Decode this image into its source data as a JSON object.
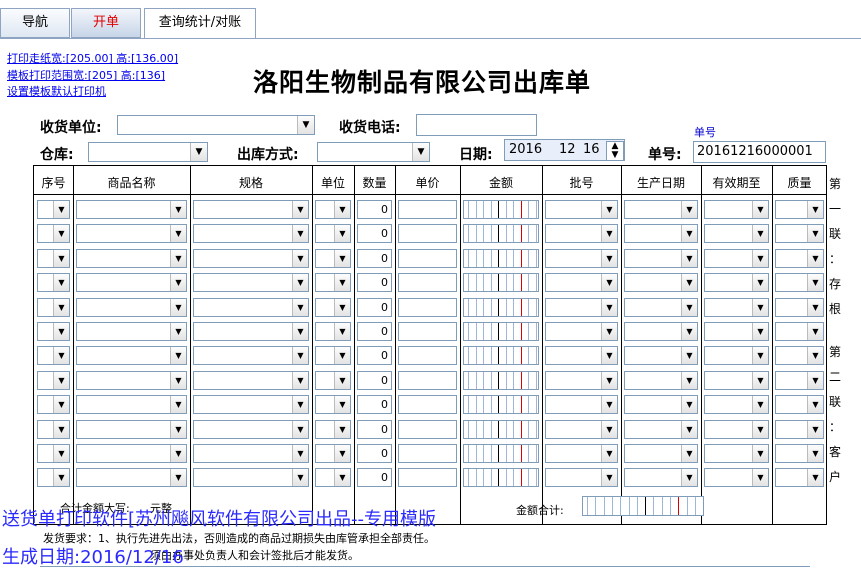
{
  "tabs": [
    {
      "label": "导航"
    },
    {
      "label": "开单"
    },
    {
      "label": "查询统计/对账"
    }
  ],
  "print_links": [
    "打印走纸宽:[205.00] 高:[136.00]",
    "模板打印范围宽:[205] 高:[136]",
    "设置模板默认打印机"
  ],
  "title": "洛阳生物制品有限公司出库单",
  "form": {
    "receiver_label": "收货单位:",
    "phone_label": "收货电话:",
    "warehouse_label": "仓库:",
    "method_label": "出库方式:",
    "date_label": "日期:",
    "date_year": "2016",
    "date_month": "12",
    "date_day": "16",
    "order_caption": "单号",
    "order_label": "单号:",
    "order_value": "20161216000001"
  },
  "columns": [
    "序号",
    "商品名称",
    "规格",
    "单位",
    "数量",
    "单价",
    "金额",
    "批号",
    "生产日期",
    "有效期至",
    "质量"
  ],
  "row_qty": [
    "0",
    "0",
    "0",
    "0",
    "0",
    "0",
    "0",
    "0",
    "0",
    "0",
    "0",
    "0"
  ],
  "side_text": [
    "第",
    "一",
    "联",
    "：",
    "存",
    "根",
    "第",
    "二",
    "联",
    "：",
    "客",
    "户"
  ],
  "footer": {
    "total_upper_label": "合计金额大写:",
    "total_upper_value": "元整",
    "total_label": "金额合计:",
    "note1": "发货要求：1、执行先进先出法，否则造成的商品过期损失由库管承担全部责任。",
    "note2": "须由办事处负责人和会计签批后才能发货。"
  },
  "watermark": {
    "line1": "送货单打印软件[苏州飚风软件有限公司出品--专用模版",
    "line2": "生成日期:2016/12/16"
  }
}
